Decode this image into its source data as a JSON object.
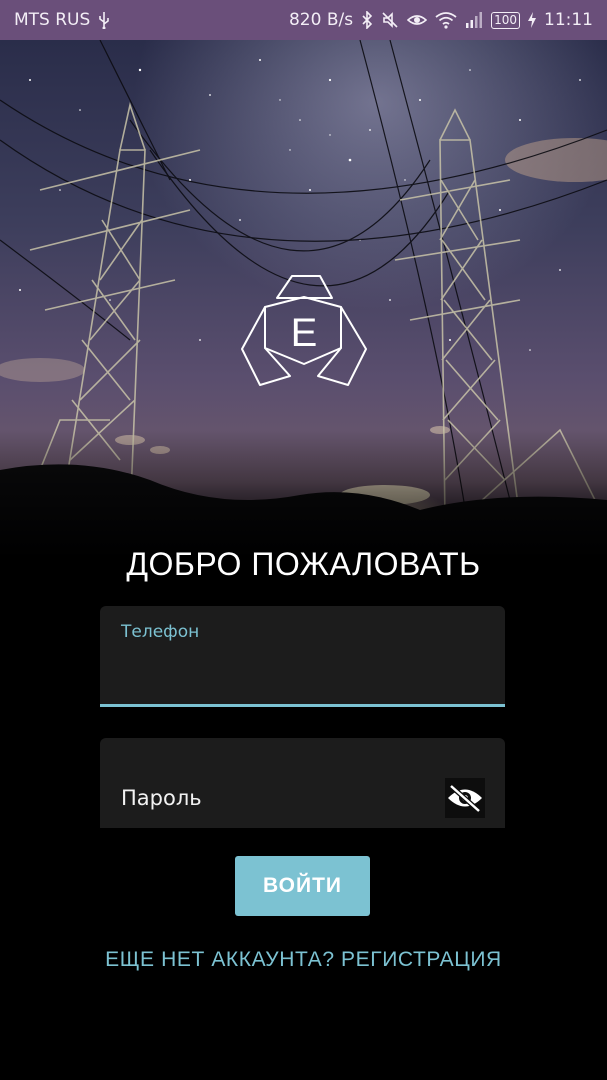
{
  "status_bar": {
    "carrier": "MTS RUS",
    "speed": "820 B/s",
    "battery": "100",
    "time": "11:11",
    "icons": [
      "usb-icon",
      "bluetooth-icon",
      "mute-icon",
      "eye-comfort-icon",
      "wifi-icon",
      "signal-icon",
      "battery-icon",
      "charging-icon"
    ]
  },
  "logo": {
    "letter": "E"
  },
  "welcome": "ДОБРО ПОЖАЛОВАТЬ",
  "phone_field": {
    "label": "Телефон",
    "value": ""
  },
  "password_field": {
    "label": "Пароль",
    "toggle_icon": "eye-off-icon"
  },
  "login_button": "ВОЙТИ",
  "register_link": "ЕЩЕ НЕТ АККАУНТА? РЕГИСТРАЦИЯ",
  "colors": {
    "accent": "#7cc2d2",
    "status_bar": "#6a4f7a",
    "field_bg": "#1c1c1c",
    "background": "#000000"
  }
}
